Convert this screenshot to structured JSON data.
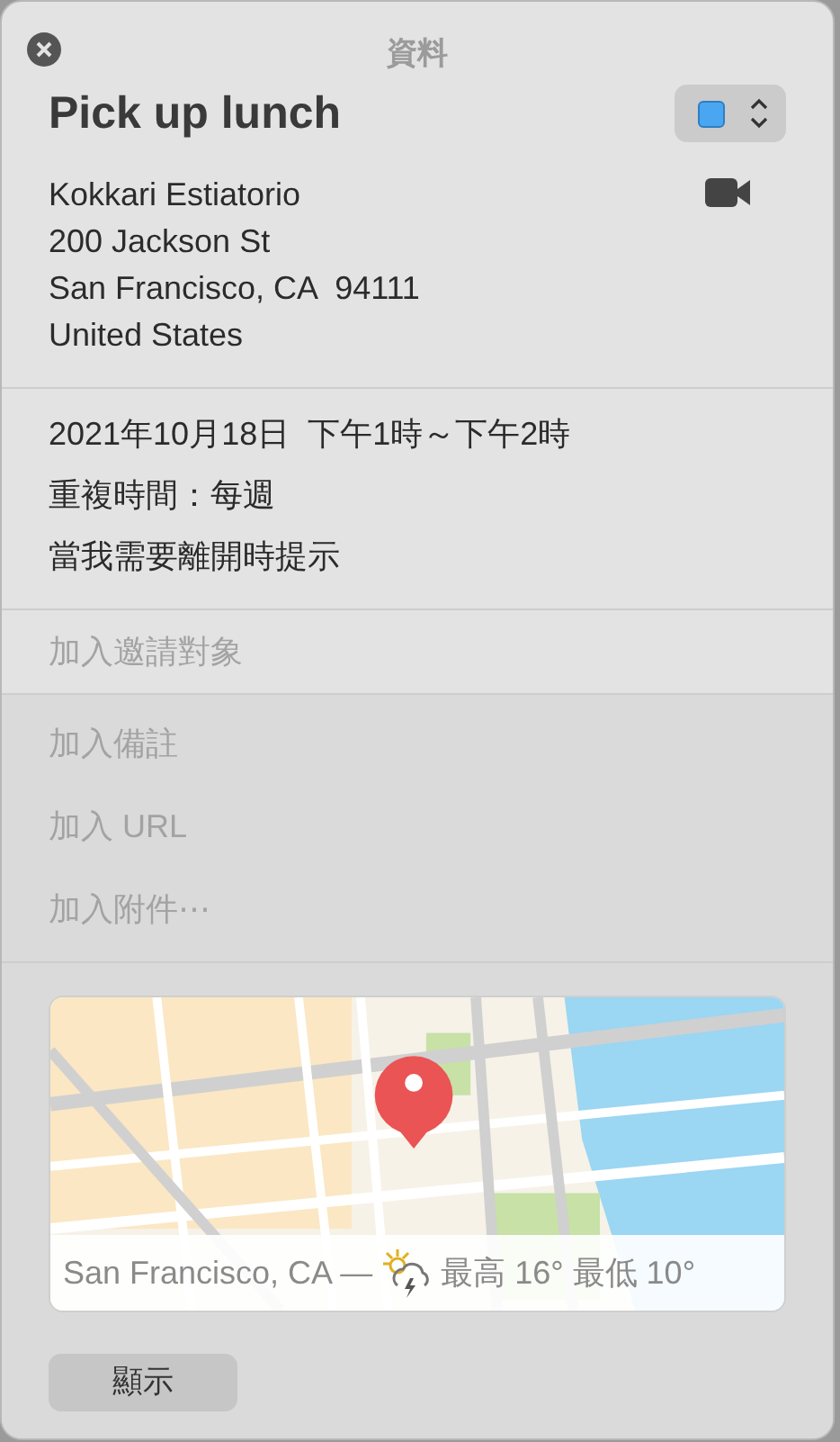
{
  "window": {
    "title": "資料"
  },
  "event": {
    "title": "Pick up lunch",
    "calendar": {
      "color": "#4aa6f0"
    },
    "location_lines": [
      "Kokkari Estiatorio",
      "200 Jackson St",
      "San Francisco, CA  94111",
      "United States"
    ]
  },
  "schedule": {
    "date_time": "2021年10月18日  下午1時～下午2時",
    "repeat": "重複時間：每週",
    "alert": "當我需要離開時提示"
  },
  "invitees": {
    "placeholder": "加入邀請對象"
  },
  "extras": [
    {
      "placeholder": "加入備註"
    },
    {
      "placeholder": "加入 URL"
    },
    {
      "placeholder": "加入附件⋯"
    }
  ],
  "map": {
    "caption": "San Francisco, CA —",
    "weather": "最高 16° 最低 10°"
  },
  "buttons": [
    "顯示"
  ]
}
